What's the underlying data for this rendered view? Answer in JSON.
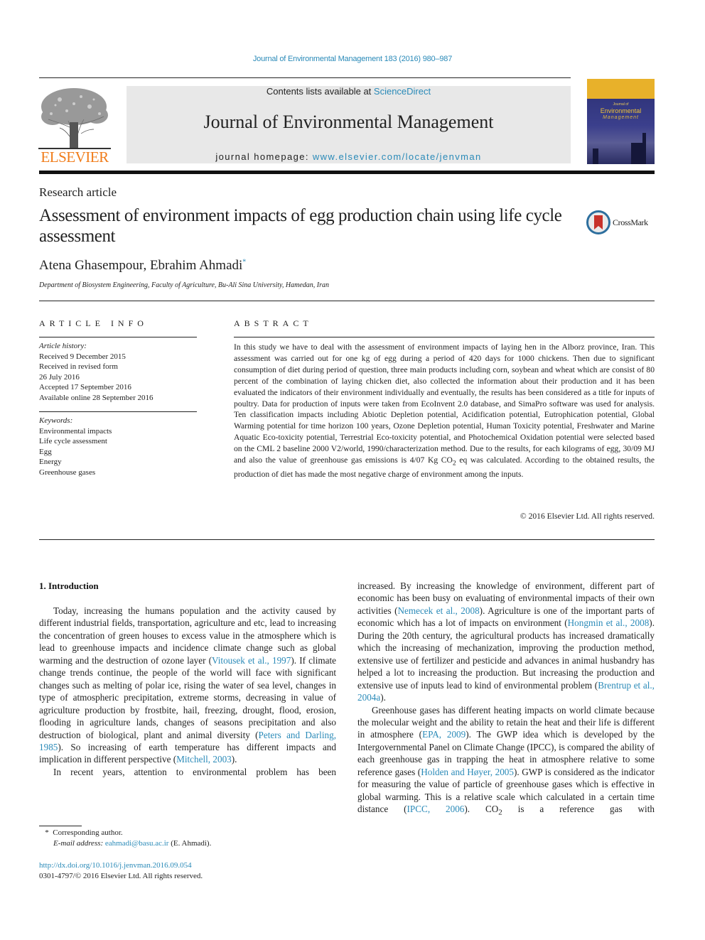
{
  "header": {
    "journal_ref": "Journal of Environmental Management 183 (2016) 980–987",
    "contents_prefix": "Contents lists available at ",
    "contents_link": "ScienceDirect",
    "journal_name": "Journal of Environmental Management",
    "homepage_prefix": "journal homepage: ",
    "homepage_link": "www.elsevier.com/locate/jenvman",
    "publisher_logo_text": "ELSEVIER",
    "cover": {
      "small": "Journal of",
      "title": "Environmental",
      "subtitle": "Management"
    }
  },
  "article": {
    "type": "Research article",
    "title": "Assessment of environment impacts of egg production chain using life cycle assessment",
    "crossmark_label": "CrossMark",
    "authors": "Atena Ghasempour, Ebrahim Ahmadi",
    "author_mark": "*",
    "affiliation": "Department of Biosystem Engineering, Faculty of Agriculture, Bu-Ali Sina University, Hamedan, Iran"
  },
  "article_info": {
    "heading": "ARTICLE INFO",
    "history_label": "Article history:",
    "history": [
      "Received 9 December 2015",
      "Received in revised form",
      "26 July 2016",
      "Accepted 17 September 2016",
      "Available online 28 September 2016"
    ],
    "keywords_label": "Keywords:",
    "keywords": [
      "Environmental impacts",
      "Life cycle assessment",
      "Egg",
      "Energy",
      "Greenhouse gases"
    ]
  },
  "abstract": {
    "heading": "ABSTRACT",
    "text_part1": "In this study we have to deal with the assessment of environment impacts of laying hen in the Alborz province, Iran. This assessment was carried out for one kg of egg during a period of 420 days for 1000 chickens. Then due to significant consumption of diet during period of question, three main products including corn, soybean and wheat which are consist of 80 percent of the combination of laying chicken diet, also collected the information about their production and it has been evaluated the indicators of their environment individually and eventually, the results has been considered as a title for inputs of poultry. Data for production of inputs were taken from EcoInvent 2.0 database, and SimaPro software was used for analysis. Ten classification impacts including Abiotic Depletion potential, Acidification potential, Eutrophication potential, Global Warming potential for time horizon 100 years, Ozone Depletion potential, Human Toxicity potential, Freshwater and Marine Aquatic Eco-toxicity potential, Terrestrial Eco-toxicity potential, and Photochemical Oxidation potential were selected based on the CML 2 baseline 2000 V2/world, 1990/characterization method. Due to the results, for each kilograms of egg, 30/09 MJ and also the value of greenhouse gas emissions is 4/07 Kg CO",
    "text_sub": "2",
    "text_part2": " eq was calculated. According to the obtained results, the production of diet has made the most negative charge of environment among the inputs.",
    "copyright": "© 2016 Elsevier Ltd. All rights reserved."
  },
  "body": {
    "intro_heading": "1.  Introduction",
    "left": {
      "p1_a": "Today, increasing the humans population and the activity caused by different industrial fields, transportation, agriculture and etc, lead to increasing the concentration of green houses to excess value in the atmosphere which is lead to greenhouse impacts and incidence climate change such as global warming and the destruction of ozone layer (",
      "p1_ref1": "Vitousek et al., 1997",
      "p1_b": "). If climate change trends continue, the people of the world will face with significant changes such as melting of polar ice, rising the water of sea level, changes in type of atmospheric precipitation, extreme storms, decreasing in value of agriculture production by frostbite, hail, freezing, drought, flood, erosion, flooding in agriculture lands, changes of seasons precipitation and also destruction of biological, plant and animal diversity (",
      "p1_ref2": "Peters and Darling, 1985",
      "p1_c": "). So increasing of earth temperature has different impacts and implication in different perspective (",
      "p1_ref3": "Mitchell, 2003",
      "p1_d": ").",
      "p2": "In recent years, attention to environmental problem has been"
    },
    "right": {
      "p1_a": "increased. By increasing the knowledge of environment, different part of economic has been busy on evaluating of environmental impacts of their own activities (",
      "p1_ref1": "Nemecek et al., 2008",
      "p1_b": "). Agriculture is one of the important parts of economic which has a lot of impacts on environment (",
      "p1_ref2": "Hongmin et al., 2008",
      "p1_c": "). During the 20th century, the agricultural products has increased dramatically which the increasing of mechanization, improving the production method, extensive use of fertilizer and pesticide and advances in animal husbandry has helped a lot to increasing the production. But increasing the production and extensive use of inputs lead to kind of environmental problem (",
      "p1_ref3": "Brentrup et al., 2004a",
      "p1_d": ").",
      "p2_a": "Greenhouse gases has different heating impacts on world climate because the molecular weight and the ability to retain the heat and their life is different in atmosphere (",
      "p2_ref1": "EPA, 2009",
      "p2_b": "). The GWP idea which is developed by the Intergovernmental Panel on Climate Change (IPCC), is compared the ability of each greenhouse gas in trapping the heat in atmosphere relative to some reference gases (",
      "p2_ref2": "Holden and Høyer, 2005",
      "p2_c": "). GWP is considered as the indicator for measuring the value of particle of greenhouse gases which is effective in global warming. This is a relative scale which calculated in a certain time distance (",
      "p2_ref3": "IPCC, 2006",
      "p2_d": "). CO",
      "p2_sub": "2",
      "p2_e": " is a reference gas with"
    }
  },
  "footnote": {
    "mark": "*",
    "corresponding": "Corresponding author.",
    "email_label": "E-mail address: ",
    "email": "eahmadi@basu.ac.ir",
    "email_suffix": " (E. Ahmadi).",
    "doi": "http://dx.doi.org/10.1016/j.jenvman.2016.09.054",
    "issn": "0301-4797/© 2016 Elsevier Ltd. All rights reserved."
  }
}
